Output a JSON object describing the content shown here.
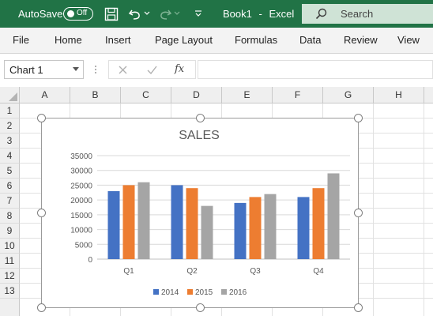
{
  "titlebar": {
    "autosave_label": "AutoSave",
    "autosave_state": "Off",
    "doc_title": "Book1",
    "title_sep": "-",
    "app_name": "Excel",
    "search_placeholder": "Search"
  },
  "ribbon": {
    "tabs": [
      "File",
      "Home",
      "Insert",
      "Page Layout",
      "Formulas",
      "Data",
      "Review",
      "View"
    ]
  },
  "formula_bar": {
    "name_box": "Chart 1",
    "fx": "fx",
    "value": ""
  },
  "sheet": {
    "columns": [
      "A",
      "B",
      "C",
      "D",
      "E",
      "F",
      "G",
      "H"
    ],
    "rows": [
      "1",
      "2",
      "3",
      "4",
      "5",
      "6",
      "7",
      "8",
      "9",
      "10",
      "11",
      "12",
      "13"
    ]
  },
  "chart_data": {
    "type": "bar",
    "title": "SALES",
    "categories": [
      "Q1",
      "Q2",
      "Q3",
      "Q4"
    ],
    "series": [
      {
        "name": "2014",
        "color": "#4472C4",
        "values": [
          23000,
          25000,
          19000,
          21000
        ]
      },
      {
        "name": "2015",
        "color": "#ED7D31",
        "values": [
          25000,
          24000,
          21000,
          24000
        ]
      },
      {
        "name": "2016",
        "color": "#A5A5A5",
        "values": [
          26000,
          18000,
          22000,
          29000
        ]
      }
    ],
    "ylim": [
      0,
      35000
    ],
    "yticks": [
      "0",
      "5000",
      "10000",
      "15000",
      "20000",
      "25000",
      "30000",
      "35000"
    ],
    "grid": true,
    "legend": "bottom"
  },
  "colors": {
    "excel_green": "#217346",
    "search_box": "#cfe3d6"
  }
}
